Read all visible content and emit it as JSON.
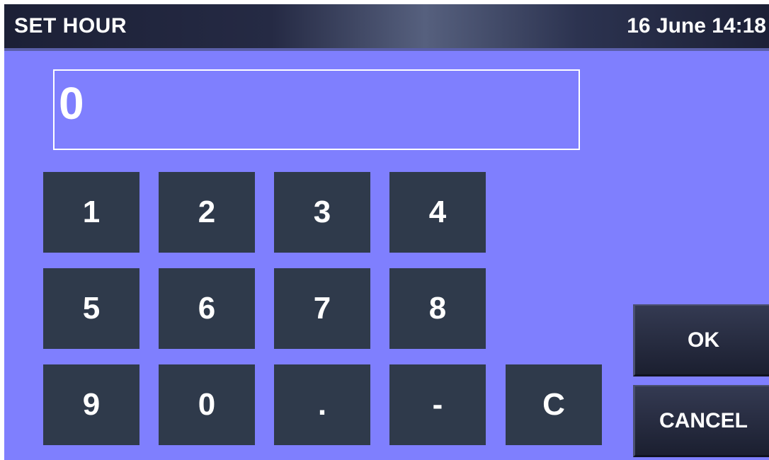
{
  "header": {
    "title": "SET HOUR",
    "datetime": "16 June 14:18"
  },
  "display": {
    "value": "0"
  },
  "keypad": {
    "keys": [
      "1",
      "2",
      "3",
      "4",
      "5",
      "6",
      "7",
      "8",
      "9",
      "0",
      ".",
      "-",
      "C"
    ]
  },
  "actions": {
    "ok_label": "OK",
    "cancel_label": "CANCEL"
  },
  "colors": {
    "background": "#7f7ffe",
    "key": "#2f3a4b",
    "header": "#1c2036",
    "text": "#ffffff"
  }
}
